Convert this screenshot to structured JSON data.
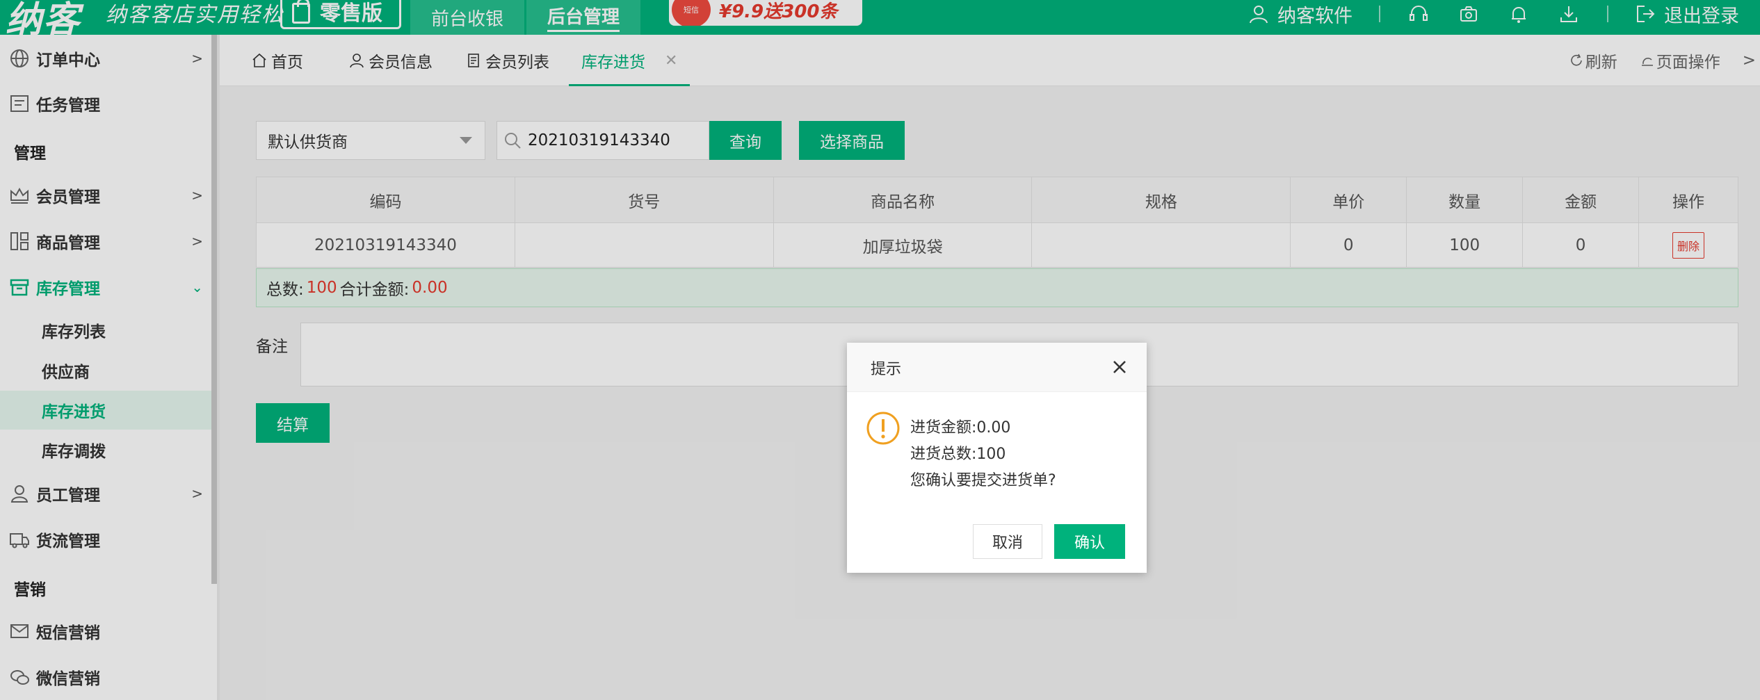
{
  "header": {
    "logo": "纳客",
    "slogan": "纳客客店实用轻松",
    "edition": "零售版",
    "nav_front": "前台收银",
    "nav_back": "后台管理",
    "promo_badge": "短信",
    "promo_text": "¥9.9送300条",
    "user_name": "纳客软件",
    "logout": "退出登录",
    "icons": [
      "user-icon",
      "headset-icon",
      "camera-icon",
      "bell-icon",
      "download-icon",
      "logout-icon"
    ]
  },
  "sidebar": {
    "items": [
      {
        "label": "订单中心",
        "icon": "globe-icon"
      },
      {
        "label": "任务管理",
        "icon": "task-icon"
      },
      {
        "label": "管理"
      },
      {
        "label": "会员管理",
        "icon": "crown-icon"
      },
      {
        "label": "商品管理",
        "icon": "product-icon"
      },
      {
        "label": "库存管理",
        "icon": "inventory-icon"
      },
      {
        "label": "库存列表"
      },
      {
        "label": "供应商"
      },
      {
        "label": "库存进货"
      },
      {
        "label": "库存调拨"
      },
      {
        "label": "员工管理",
        "icon": "staff-icon"
      },
      {
        "label": "货流管理",
        "icon": "truck-icon"
      },
      {
        "label": "营销"
      },
      {
        "label": "短信营销",
        "icon": "mail-icon"
      },
      {
        "label": "微信营销",
        "icon": "wechat-icon"
      }
    ]
  },
  "tabs": {
    "items": [
      "首页",
      "会员信息",
      "会员列表",
      "库存进货"
    ],
    "refresh": "刷新",
    "page_ops": "页面操作"
  },
  "form": {
    "supplier": "默认供货商",
    "search_value": "20210319143340",
    "query": "查询",
    "select_goods": "选择商品",
    "remark_label": "备注",
    "settle": "结算"
  },
  "table": {
    "headers": [
      "编码",
      "货号",
      "商品名称",
      "规格",
      "单价",
      "数量",
      "金额",
      "操作"
    ],
    "rows": [
      {
        "code": "20210319143340",
        "sku": "",
        "name": "加厚垃圾袋",
        "spec": "",
        "price": "0",
        "qty": "100",
        "amount": "0",
        "action": "删除"
      }
    ]
  },
  "summary": {
    "total_label": "总数:",
    "total_value": "100",
    "amount_label": "合计金额:",
    "amount_value": "0.00"
  },
  "dialog": {
    "title": "提示",
    "line1": "进货金额:0.00",
    "line2": "进货总数:100",
    "line3": "您确认要提交进货单?",
    "cancel": "取消",
    "confirm": "确认"
  },
  "colors": {
    "brand": "#00b27c",
    "danger": "#e5392d",
    "warning": "#f0a020"
  }
}
